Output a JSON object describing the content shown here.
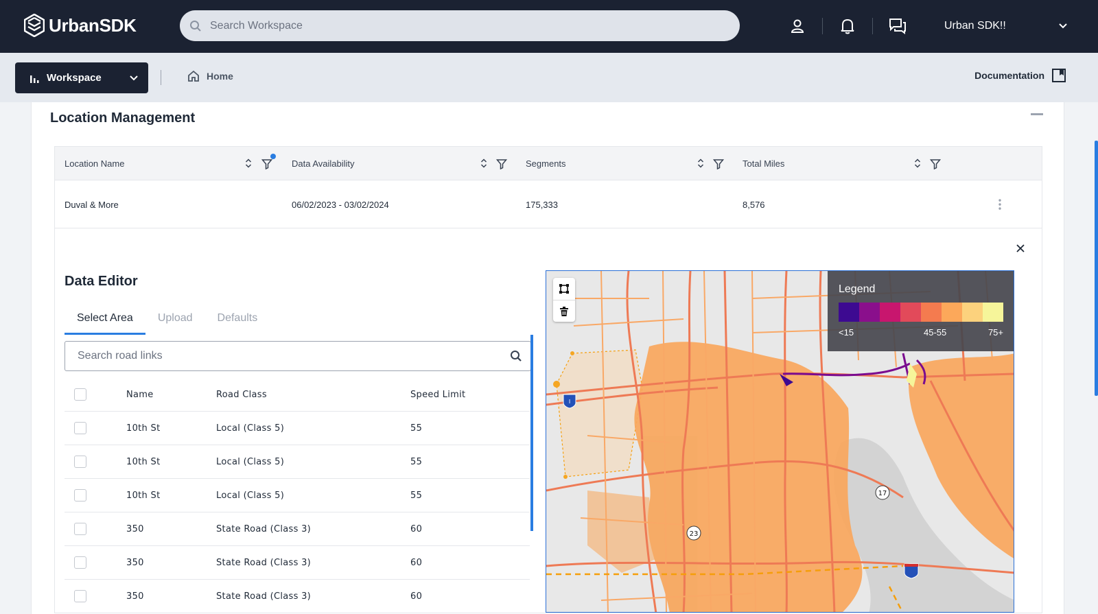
{
  "app": {
    "brand": "UrbanSDK",
    "search_placeholder": "Search Workspace",
    "user_name": "Urban SDK!!"
  },
  "subbar": {
    "workspace_label": "Workspace",
    "home_label": "Home",
    "documentation_label": "Documentation"
  },
  "location_management": {
    "title": "Location Management",
    "columns": [
      "Location Name",
      "Data Availability",
      "Segments",
      "Total Miles"
    ],
    "rows": [
      {
        "name": "Duval & More",
        "availability": "06/02/2023 - 03/02/2024",
        "segments": "175,333",
        "miles": "8,576"
      }
    ]
  },
  "data_editor": {
    "title": "Data Editor",
    "tabs": [
      "Select Area",
      "Upload",
      "Defaults"
    ],
    "active_tab": "Select Area",
    "search_placeholder": "Search road links",
    "columns": [
      "Name",
      "Road Class",
      "Speed Limit"
    ],
    "rows": [
      {
        "name": "10th St",
        "road_class": "Local (Class 5)",
        "speed": "55"
      },
      {
        "name": "10th St",
        "road_class": "Local (Class 5)",
        "speed": "55"
      },
      {
        "name": "10th St",
        "road_class": "Local (Class 5)",
        "speed": "55"
      },
      {
        "name": "350",
        "road_class": "State Road (Class 3)",
        "speed": "60"
      },
      {
        "name": "350",
        "road_class": "State Road (Class 3)",
        "speed": "60"
      },
      {
        "name": "350",
        "road_class": "State Road (Class 3)",
        "speed": "60"
      }
    ]
  },
  "map": {
    "legend_title": "Legend",
    "legend_colors": [
      "#3d0a91",
      "#8a0f8c",
      "#c8166e",
      "#e24a5a",
      "#f47b4f",
      "#fca85a",
      "#fcd27d",
      "#f6f59a"
    ],
    "legend_labels": [
      "<15",
      "45-55",
      "75+"
    ],
    "route_markers": [
      "17",
      "23",
      "I"
    ]
  },
  "colors": {
    "topbar_bg": "#1b2232",
    "accent": "#2a7de1",
    "road_orange": "#f7a660",
    "road_red": "#ee6a4c"
  }
}
